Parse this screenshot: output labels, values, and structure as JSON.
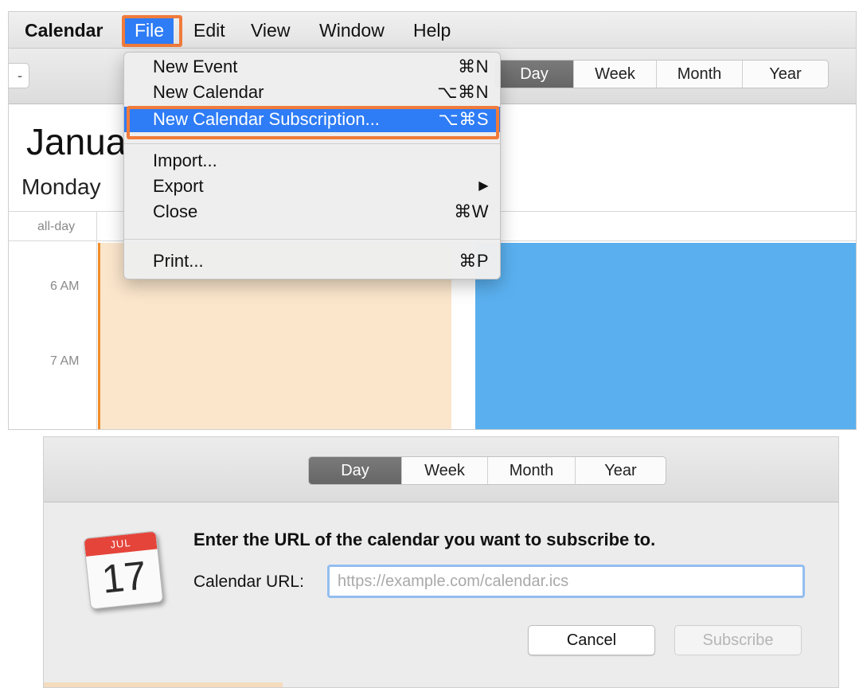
{
  "menubar": {
    "app": "Calendar",
    "items": [
      "File",
      "Edit",
      "View",
      "Window",
      "Help"
    ]
  },
  "view_switcher": [
    "Day",
    "Week",
    "Month",
    "Year"
  ],
  "view_switcher_active": "Day",
  "calendar": {
    "title": "Janua",
    "weekday": "Monday",
    "allday_label": "all-day",
    "hours": [
      "6 AM",
      "7 AM"
    ],
    "colors": {
      "event_orange": "#fbe6cc",
      "event_blue": "#5ab0ef"
    }
  },
  "file_menu": {
    "items": [
      {
        "label": "New Event",
        "shortcut": "⌘N"
      },
      {
        "label": "New Calendar",
        "shortcut": "⌥⌘N"
      },
      {
        "label": "New Calendar Subscription...",
        "shortcut": "⌥⌘S",
        "highlighted": true
      },
      {
        "label": "Import...",
        "shortcut": ""
      },
      {
        "label": "Export",
        "shortcut": "▶"
      },
      {
        "label": "Close",
        "shortcut": "⌘W"
      },
      {
        "label": "Print...",
        "shortcut": "⌘P"
      }
    ]
  },
  "toolbar_stub": "-",
  "dialog": {
    "icon": {
      "month": "JUL",
      "day": "17"
    },
    "prompt": "Enter the URL of the calendar you want to subscribe to.",
    "url_label": "Calendar URL:",
    "url_placeholder": "https://example.com/calendar.ics",
    "url_value": "",
    "cancel": "Cancel",
    "subscribe": "Subscribe"
  },
  "accent_colors": {
    "menu_highlight": "#2e7cf6",
    "annotation": "#f07b3b"
  }
}
